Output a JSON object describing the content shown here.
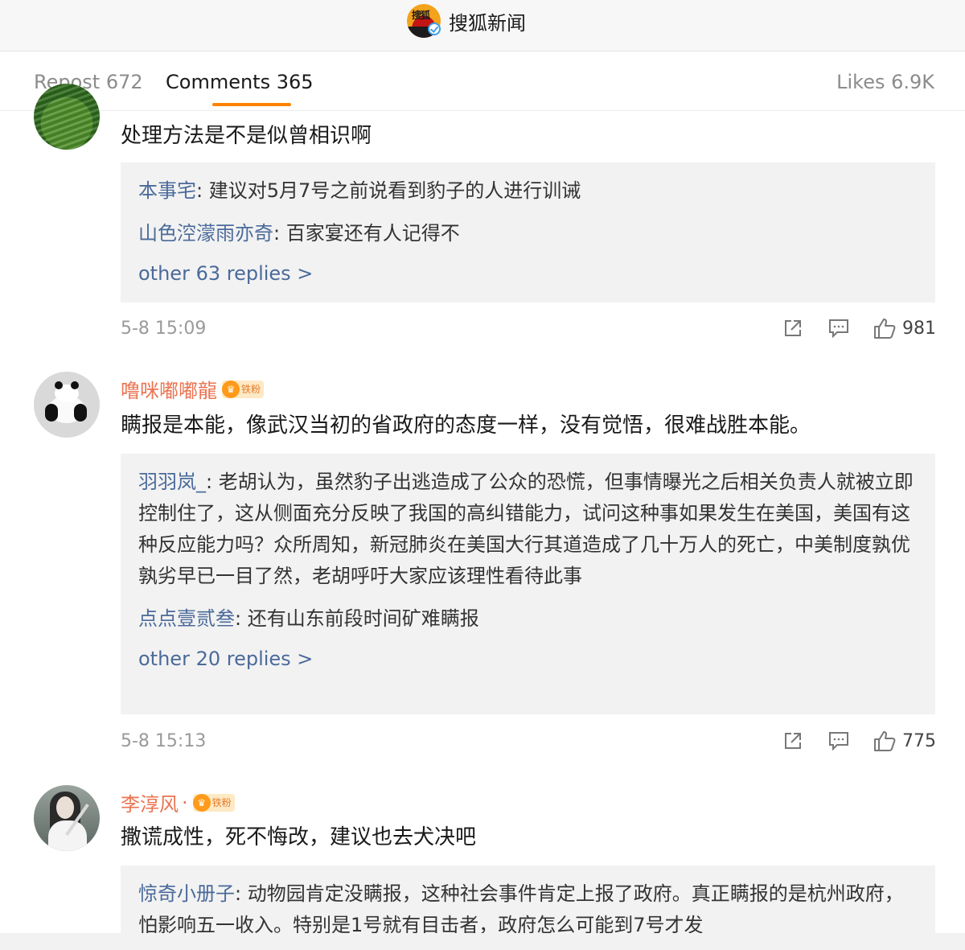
{
  "header": {
    "account_name": "搜狐新闻",
    "logo_text": "搜狐"
  },
  "tabs": {
    "repost": "Repost 672",
    "comments": "Comments 365",
    "likes": "Likes 6.9K"
  },
  "comments": [
    {
      "username": "",
      "text": "处理方法是不是似曾相识啊",
      "replies": [
        {
          "name": "本事宅",
          "text": ": 建议对5月7号之前说看到豹子的人进行训诫"
        },
        {
          "name": "山色涳濛雨亦奇",
          "text": ": 百家宴还有人记得不"
        }
      ],
      "more": "other 63 replies >",
      "time": "5-8 15:09",
      "likes": "981"
    },
    {
      "username": "噜咪嘟嘟龍",
      "badge": "铁粉",
      "text": "瞒报是本能，像武汉当初的省政府的态度一样，没有觉悟，很难战胜本能。",
      "replies": [
        {
          "name": "羽羽岚_",
          "text": ": 老胡认为，虽然豹子出逃造成了公众的恐慌，但事情曝光之后相关负责人就被立即控制住了，这从侧面充分反映了我国的高纠错能力，试问这种事如果发生在美国，美国有这种反应能力吗？众所周知，新冠肺炎在美国大行其道造成了几十万人的死亡，中美制度孰优孰劣早已一目了然，老胡呼吁大家应该理性看待此事"
        },
        {
          "name": "点点壹贰叁",
          "text": ": 还有山东前段时间矿难瞒报"
        }
      ],
      "more": "other 20 replies >",
      "time": "5-8 15:13",
      "likes": "775"
    },
    {
      "username": "李淳风",
      "username_dot": "·",
      "badge": "铁粉",
      "text": "撒谎成性，死不悔改，建议也去犬决吧",
      "replies": [
        {
          "name": "惊奇小册子",
          "text": ": 动物园肯定没瞒报，这种社会事件肯定上报了政府。真正瞒报的是杭州政府，怕影响五一收入。特别是1号就有目击者，政府怎么可能到7号才发"
        }
      ]
    }
  ],
  "colors": {
    "accent": "#ff8200",
    "username": "#eb7350",
    "reply_name": "#4a6a9a",
    "reply_bg": "#f2f2f2"
  }
}
